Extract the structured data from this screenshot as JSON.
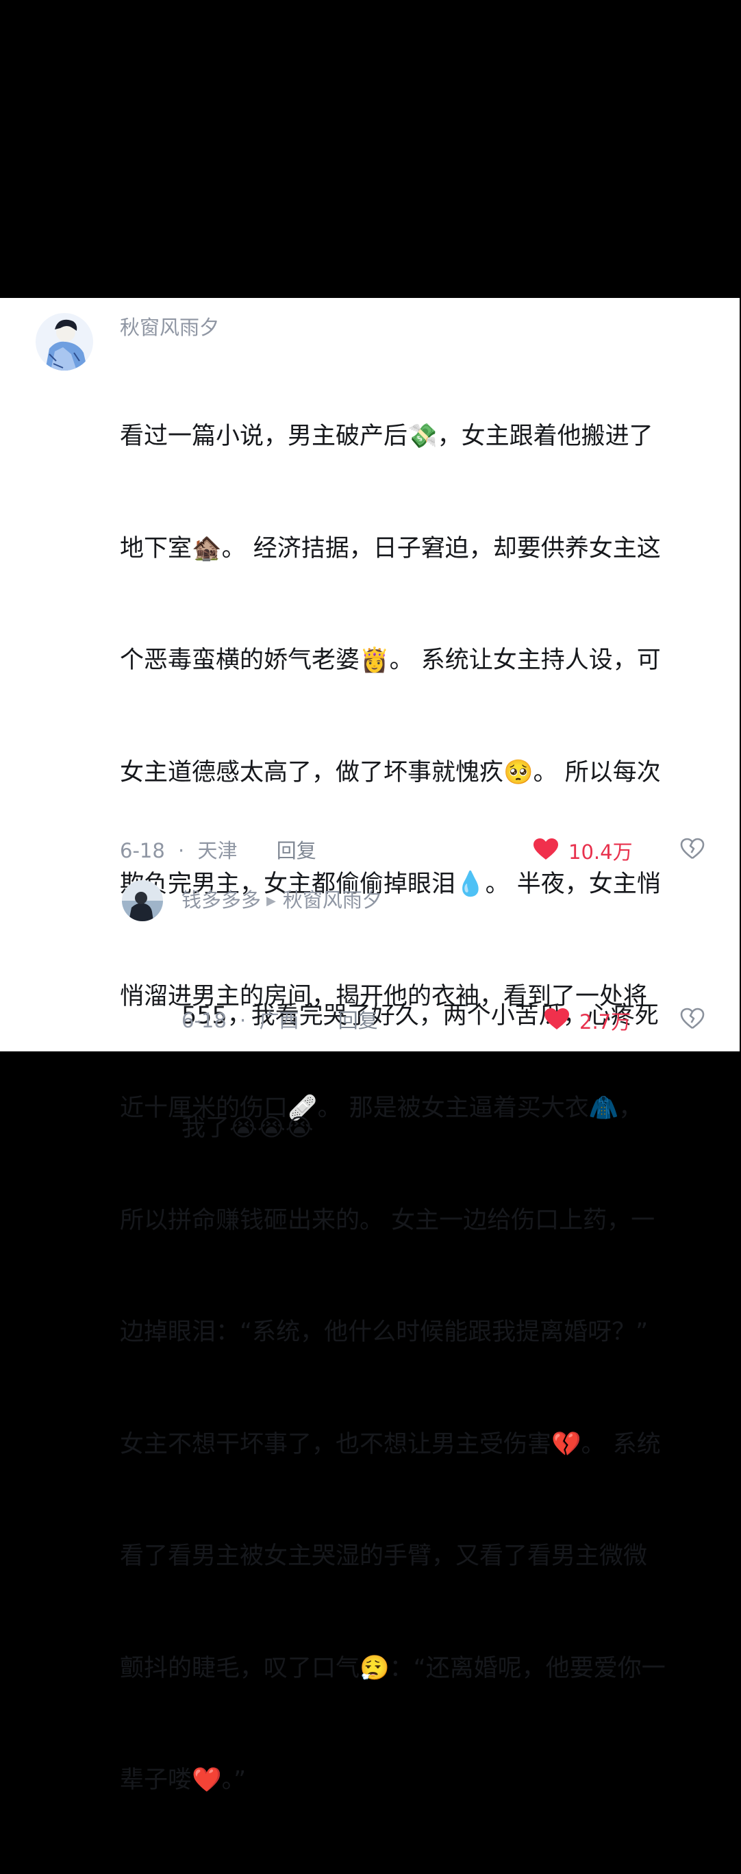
{
  "comments": [
    {
      "username": "秋窗风雨夕",
      "lines": [
        "看过一篇小说，男主破产后💸，女主跟着他搬进了",
        "地下室🏚️。 经济拮据，日子窘迫，却要供养女主这",
        "个恶毒蛮横的娇气老婆👸。 系统让女主持人设，可",
        "女主道德感太高了，做了坏事就愧疚🥺。 所以每次",
        "欺负完男主，女主都偷偷掉眼泪💧。 半夜，女主悄",
        "悄溜进男主的房间，揭开他的衣袖，看到了一处将",
        "近十厘米的伤口🩹。 那是被女主逼着买大衣🧥，",
        "所以拼命赚钱砸出来的。 女主一边给伤口上药，一",
        "边掉眼泪：“系统，他什么时候能跟我提离婚呀？”",
        "女主不想干坏事了，也不想让男主受伤害💔。 系统",
        "看了看男主被女主哭湿的手臂，又看了看男主微微",
        "颤抖的睫毛，叹了口气😮‍💨：“还离婚呢，他要爱你一",
        "辈子喽❤️。”"
      ],
      "date": "6-18",
      "separator": "·",
      "location": "天津",
      "reply_label": "回复",
      "likes": "10.4万",
      "colors": {
        "like": "#f0304c"
      }
    },
    {
      "username": "钱多多多",
      "reply_to": "秋窗风雨夕",
      "reply_arrow": "▶",
      "lines": [
        "555，我看完哭了好久，两个小苦瓜，心疼死",
        "我了😭😭😭"
      ],
      "date": "6-18",
      "separator": "·",
      "location": "广西",
      "reply_label": "回复",
      "likes": "2.7万",
      "colors": {
        "like": "#f0304c"
      }
    }
  ],
  "icons": {
    "like": "heart-filled-icon",
    "dislike": "broken-heart-outline-icon"
  }
}
